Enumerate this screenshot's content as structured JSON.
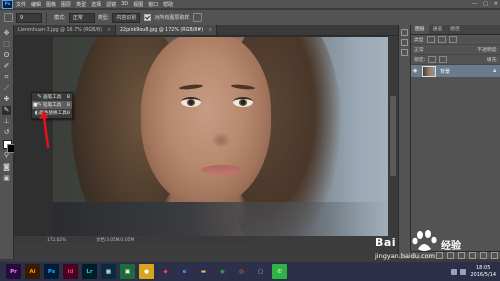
{
  "menubar": {
    "logo": "Ps",
    "items": [
      "文件",
      "编辑",
      "图像",
      "图层",
      "类型",
      "选择",
      "滤镜",
      "3D",
      "视图",
      "窗口",
      "帮助"
    ],
    "window_controls": [
      "—",
      "□",
      "✕"
    ]
  },
  "options": {
    "size_value": "9",
    "mode_label": "模式:",
    "mode_value": "正常",
    "type_label": "类型:",
    "type_value": "内容识别",
    "sample_label": "对所有图层取样"
  },
  "tabs": [
    {
      "label": "Lierenhuan-3.jpg @ 16.7% (RGB/8)",
      "close": "×",
      "active": false
    },
    {
      "label": "22pink9ou8.jpg @ 172% (RGB/8#)",
      "close": "×",
      "active": true
    }
  ],
  "flyout": {
    "items": [
      {
        "bullet": "",
        "icon": "✎",
        "label": "画笔工具",
        "key": "B",
        "selected": false
      },
      {
        "bullet": "■",
        "icon": "✎",
        "label": "铅笔工具",
        "key": "B",
        "selected": true
      },
      {
        "bullet": "",
        "icon": "◐",
        "label": "颜色替换工具",
        "key": "B",
        "selected": false
      }
    ]
  },
  "status": {
    "zoom": "172.02%",
    "doc": "文档:3.05M/3.05M"
  },
  "panel": {
    "tabs": [
      "图层",
      "通道",
      "路径"
    ],
    "kind_label": "类型",
    "blend_mode": "正常",
    "opacity_label": "不透明度:",
    "lock_label": "锁定:",
    "fill_label": "填充:",
    "layer_name": "背景",
    "layer_visible_icon": "eye-icon"
  },
  "watermark": {
    "text_left": "Bai",
    "text_right": "经验",
    "url": "jingyan.baidu.com"
  },
  "taskbar": {
    "apps": [
      {
        "label": "Pr",
        "bg": "#2a0a3a",
        "fg": "#e58fff",
        "icon": "premiere-icon"
      },
      {
        "label": "Ai",
        "bg": "#3a1a00",
        "fg": "#ff9a00",
        "icon": "illustrator-icon"
      },
      {
        "label": "Ps",
        "bg": "#001d33",
        "fg": "#31a8ff",
        "icon": "photoshop-icon",
        "active": true
      },
      {
        "label": "Id",
        "bg": "#49021f",
        "fg": "#ff3366",
        "icon": "indesign-icon"
      },
      {
        "label": "Lr",
        "bg": "#001d26",
        "fg": "#31c5f0",
        "icon": "lightroom-icon"
      },
      {
        "label": "▦",
        "bg": "#0a2a40",
        "fg": "#ffffff",
        "icon": "media-icon"
      },
      {
        "label": "▣",
        "bg": "#1e6b3a",
        "fg": "#ffffff",
        "icon": "app-icon"
      },
      {
        "label": "●",
        "bg": "#d7a41a",
        "fg": "#ffffff",
        "icon": "browser-icon"
      },
      {
        "label": "◆",
        "bg": "#2d2f4c",
        "fg": "#ff4444",
        "icon": "qq-icon"
      },
      {
        "label": "e",
        "bg": "#2d2f4c",
        "fg": "#3fa9f5",
        "icon": "ie-icon"
      },
      {
        "label": "▬",
        "bg": "#2d2f4c",
        "fg": "#e0c070",
        "icon": "folder-icon"
      },
      {
        "label": "◉",
        "bg": "#2d2f4c",
        "fg": "#2fb344",
        "icon": "chrome-icon"
      },
      {
        "label": "◎",
        "bg": "#2d2f4c",
        "fg": "#ff7a1a",
        "icon": "firefox-icon"
      },
      {
        "label": "▢",
        "bg": "#2d2f4c",
        "fg": "#9ad3ff",
        "icon": "window-icon"
      },
      {
        "label": "✆",
        "bg": "#2fb344",
        "fg": "#ffffff",
        "icon": "wechat-icon"
      }
    ],
    "clock_time": "18:05",
    "clock_date": "2016/5/14"
  }
}
